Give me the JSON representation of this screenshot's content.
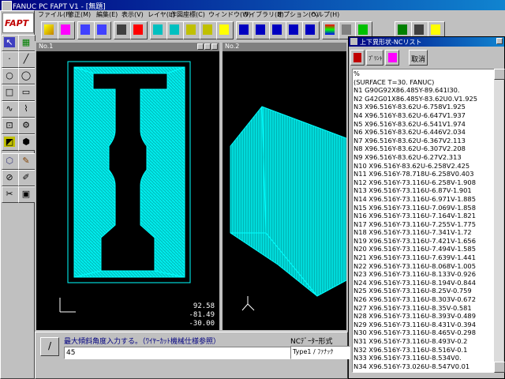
{
  "app": {
    "title": "FANUC PC FAPT V1 - [無題]",
    "logo": "FAPT"
  },
  "menu": [
    "ファイル(F)",
    "修正(M)",
    "編集(E)",
    "表示(V)",
    "レイヤ(L)",
    "作図座標(C)",
    "ウィンドウ(W)",
    "ライブラリ(B)",
    "オプション(O)",
    "ヘルプ(H)"
  ],
  "toolbar": {
    "icons": [
      "folder-icon",
      "save-icon",
      "undo-icon",
      "redo-icon",
      "arrow-icon",
      "delete-icon",
      "view-icon",
      "zoom-icon",
      "rotate-icon",
      "fit-icon",
      "shade-icon",
      "pan-icon",
      "zoom-window-icon",
      "zoom-all-icon",
      "redraw-icon",
      "expand-icon",
      "grid-icon",
      "layers-icon",
      "list-icon",
      "color-icon",
      "cut-icon",
      "calc-icon",
      "machine-icon",
      "run-icon",
      "nc-icon"
    ],
    "colors": {
      "accent": "#00ffff",
      "bg": "#c0c0c0",
      "title": "#000080"
    }
  },
  "windows": {
    "w1": {
      "title": "No.1",
      "coords": [
        "92.58",
        "-81.49",
        "-30.00"
      ]
    },
    "w2": {
      "title": "No.2"
    }
  },
  "nclist": {
    "title": "上下異形状-NCリスト",
    "buttons": {
      "print": "ﾌﾟﾘﾝﾄ",
      "save": "",
      "cancel": "取消"
    },
    "lines": [
      "%",
      "(SURFACE T=30. FANUC)",
      "N1 G90G92X86.485Y-89.641I30.",
      "N2 G42G01X86.485Y-83.62U0.V1.925",
      "N3 X96.516Y-83.62U-6.758V1.925",
      "N4 X96.516Y-83.62U-6.647V1.937",
      "N5 X96.516Y-83.62U-6.541V1.974",
      "N6 X96.516Y-83.62U-6.446V2.034",
      "N7 X96.516Y-83.62U-6.367V2.113",
      "N8 X96.516Y-83.62U-6.307V2.208",
      "N9 X96.516Y-83.62U-6.27V2.313",
      "N10 X96.516Y-83.62U-6.258V2.425",
      "N11 X96.516Y-78.718U-6.258V0.403",
      "N12 X96.516Y-73.116U-6.258V-1.908",
      "N13 X96.516Y-73.116U-6.87V-1.901",
      "N14 X96.516Y-73.116U-6.971V-1.885",
      "N15 X96.516Y-73.116U-7.069V-1.858",
      "N16 X96.516Y-73.116U-7.164V-1.821",
      "N17 X96.516Y-73.116U-7.255V-1.775",
      "N18 X96.516Y-73.116U-7.341V-1.72",
      "N19 X96.516Y-73.116U-7.421V-1.656",
      "N20 X96.516Y-73.116U-7.494V-1.585",
      "N21 X96.516Y-73.116U-7.639V-1.441",
      "N22 X96.516Y-73.116U-8.068V-1.005",
      "N23 X96.516Y-73.116U-8.133V-0.926",
      "N24 X96.516Y-73.116U-8.194V-0.844",
      "N25 X96.516Y-73.116U-8.25V-0.759",
      "N26 X96.516Y-73.116U-8.303V-0.672",
      "N27 X96.516Y-73.116U-8.35V-0.581",
      "N28 X96.516Y-73.116U-8.393V-0.489",
      "N29 X96.516Y-73.116U-8.431V-0.394",
      "N30 X96.516Y-73.116U-8.465V-0.298",
      "N31 X96.516Y-73.116U-8.493V-0.2",
      "N32 X96.516Y-73.116U-8.516V-0.1",
      "N33 X96.516Y-73.116U-8.534V0.",
      "N34 X96.516Y-73.026U-8.547V0.01"
    ]
  },
  "bottom": {
    "slash": "/",
    "prompt": "最大傾斜角度入力する。（ﾜｲﾔｰｶｯﾄ機械仕様参照）",
    "input_value": "45",
    "ncformat_label": "NCﾃﾞｰﾀｰ形式",
    "ncformat_value": "Type1 / ﾌｧﾅｯｸ"
  }
}
